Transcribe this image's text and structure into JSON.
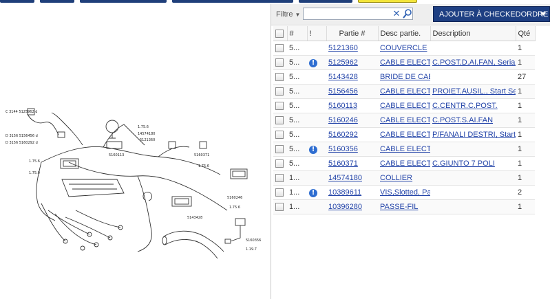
{
  "filter": {
    "label": "Filtre",
    "value": "",
    "placeholder": ""
  },
  "toolbar": {
    "add_label": "AJOUTER À CHECKEDORDRE"
  },
  "table": {
    "headers": {
      "num": "#",
      "flag": "!",
      "part": "Partie #",
      "desc": "Desc partie.",
      "description": "Description",
      "qty": "Qté"
    },
    "rows": [
      {
        "num": "5...",
        "info": false,
        "part": "5121360",
        "desc": "COUVERCLE",
        "description": "",
        "qty": "1"
      },
      {
        "num": "5...",
        "info": true,
        "part": "5125962",
        "desc": "CABLE ELECTR",
        "description": "C.POST.D.AI.FAN, Serial I",
        "qty": "1"
      },
      {
        "num": "5...",
        "info": false,
        "part": "5143428",
        "desc": "BRIDE DE CABL",
        "description": "",
        "qty": "27"
      },
      {
        "num": "5...",
        "info": false,
        "part": "5156456",
        "desc": "CABLE ELECTR",
        "description": "PROIET.AUSIL., Start Seri",
        "qty": "1"
      },
      {
        "num": "5...",
        "info": false,
        "part": "5160113",
        "desc": "CABLE ELECTR",
        "description": "C.CENTR.C.POST.",
        "qty": "1"
      },
      {
        "num": "5...",
        "info": false,
        "part": "5160246",
        "desc": "CABLE ELECTR",
        "description": "C.POST.S.AI.FAN",
        "qty": "1"
      },
      {
        "num": "5...",
        "info": false,
        "part": "5160292",
        "desc": "CABLE ELECTR",
        "description": "P/FANALI DESTRI, Start S",
        "qty": "1"
      },
      {
        "num": "5...",
        "info": true,
        "part": "5160356",
        "desc": "CABLE ELECTR",
        "description": "",
        "qty": "1"
      },
      {
        "num": "5...",
        "info": false,
        "part": "5160371",
        "desc": "CABLE ELECTR",
        "description": "C.GIUNTO 7 POLI",
        "qty": "1"
      },
      {
        "num": "1...",
        "info": false,
        "part": "14574180",
        "desc": "COLLIER",
        "description": "",
        "qty": "1"
      },
      {
        "num": "1...",
        "info": true,
        "part": "10389611",
        "desc": "VIS,Slotted, Par",
        "description": "",
        "qty": "2"
      },
      {
        "num": "1...",
        "info": false,
        "part": "10396280",
        "desc": "PASSE-FIL",
        "description": "",
        "qty": "1"
      }
    ]
  },
  "diagram": {
    "labels": {
      "l1": "C 3144  5125962  d",
      "l2": "D 3156  5156456  d",
      "l3": "D 3156  5160292  d",
      "l4": "1.75.6",
      "l5": "1.75.0",
      "l6": "5160113",
      "l7": "1.75.6",
      "l8": "14574180",
      "l9": "5121360",
      "l10": "5160371",
      "l11": "1.75.6",
      "l12": "5160246",
      "l13": "1.75.6",
      "l14": "5143428",
      "l15": "5160356",
      "l16": "1.19.7"
    }
  },
  "colors": {
    "accent": "#1e3f82",
    "link": "#2243a8",
    "info": "#2f6ed1"
  }
}
